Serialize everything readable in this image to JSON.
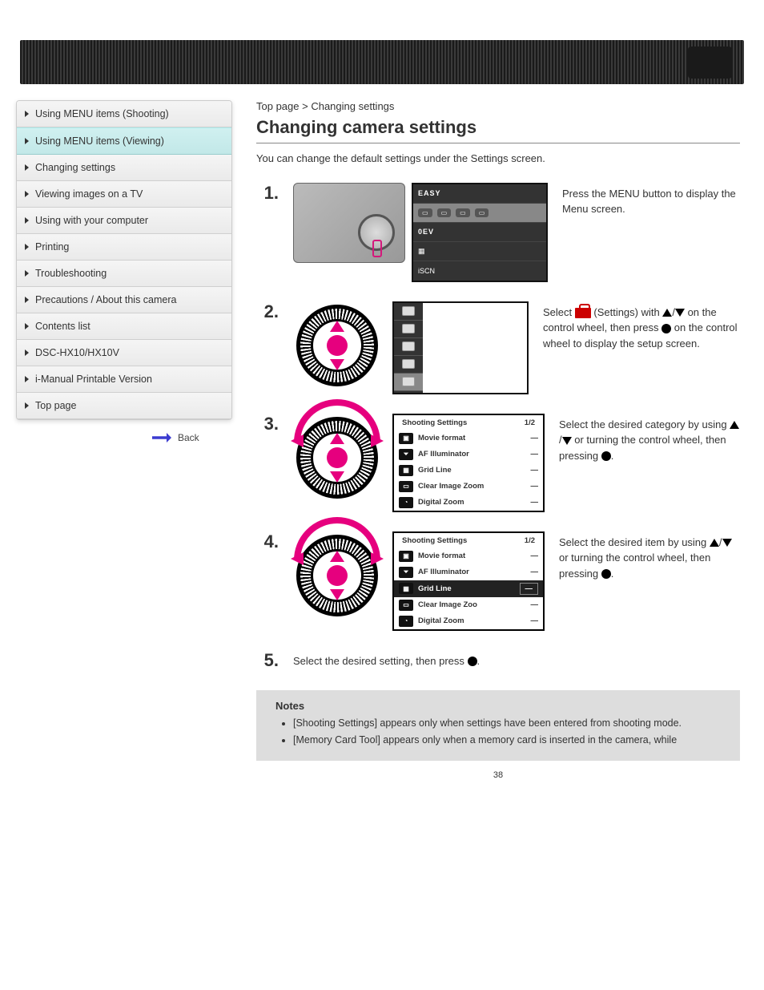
{
  "sidebar": {
    "items": [
      {
        "label": "Using MENU items (Shooting)"
      },
      {
        "label": "Using MENU items (Viewing)"
      },
      {
        "label": "Changing settings"
      },
      {
        "label": "Viewing images on a TV"
      },
      {
        "label": "Using with your computer"
      },
      {
        "label": "Printing"
      },
      {
        "label": "Troubleshooting"
      },
      {
        "label": "Precautions / About this camera"
      },
      {
        "label": "Contents list"
      },
      {
        "label": "DSC-HX10/HX10V"
      },
      {
        "label": "i-Manual Printable Version"
      },
      {
        "label": "Top page"
      }
    ],
    "active_index": 1,
    "back_label": "Back"
  },
  "crumbs": [
    "Top page",
    "Changing settings"
  ],
  "title": "Changing camera settings",
  "intro": "You can change the default settings under the Settings screen.",
  "steps": [
    {
      "num": "1",
      "text_parts": [
        "Press the MENU button to display the Menu screen."
      ],
      "fig": "camera_lcd"
    },
    {
      "num": "2",
      "text_parts": [
        "Select ",
        "{toolbox}",
        " (Settings) with ",
        "{up}",
        "/",
        "{down}",
        " on the control wheel, then press ",
        "{dot}",
        " on the control wheel to display the setup screen."
      ],
      "fig": "wheel_lcd2"
    },
    {
      "num": "3",
      "text_parts": [
        "Select the desired category by using ",
        "{up}",
        "/",
        "{down}",
        " or turning the control wheel, then pressing ",
        "{dot}",
        "."
      ],
      "fig": "wheel_settings"
    },
    {
      "num": "4",
      "text_parts": [
        "Select the desired item by using ",
        "{up}",
        "/",
        "{down}",
        " or turning the control wheel, then pressing ",
        "{dot}",
        "."
      ],
      "fig": "wheel_settings_sel"
    },
    {
      "num": "5",
      "text_parts": [
        "Select the desired setting, then press ",
        "{dot}",
        "."
      ],
      "fig": "none"
    }
  ],
  "lcd1": {
    "rows": [
      {
        "big": "EASY"
      },
      {
        "badges": 4
      },
      {
        "big": "0EV"
      },
      {
        "icon": "▦"
      },
      {
        "icon": "iSCN"
      }
    ]
  },
  "settings_panel": {
    "title": "Shooting Settings",
    "page": "1/2",
    "rows": [
      {
        "label": "Movie format",
        "val": "—"
      },
      {
        "label": "AF Illuminator",
        "val": "—"
      },
      {
        "label": "Grid Line",
        "val": "—"
      },
      {
        "label": "Clear Image Zoom",
        "val": "—"
      },
      {
        "label": "Digital Zoom",
        "val": "—"
      }
    ],
    "selected_second": "Grid Line",
    "selected_clip": "Clear Image Zoo"
  },
  "notes": {
    "title": "Notes",
    "items": [
      "[Shooting Settings] appears only when settings have been entered from shooting mode.",
      "[Memory Card Tool] appears only when a memory card is inserted in the camera, while"
    ]
  },
  "pagefoot": "38"
}
